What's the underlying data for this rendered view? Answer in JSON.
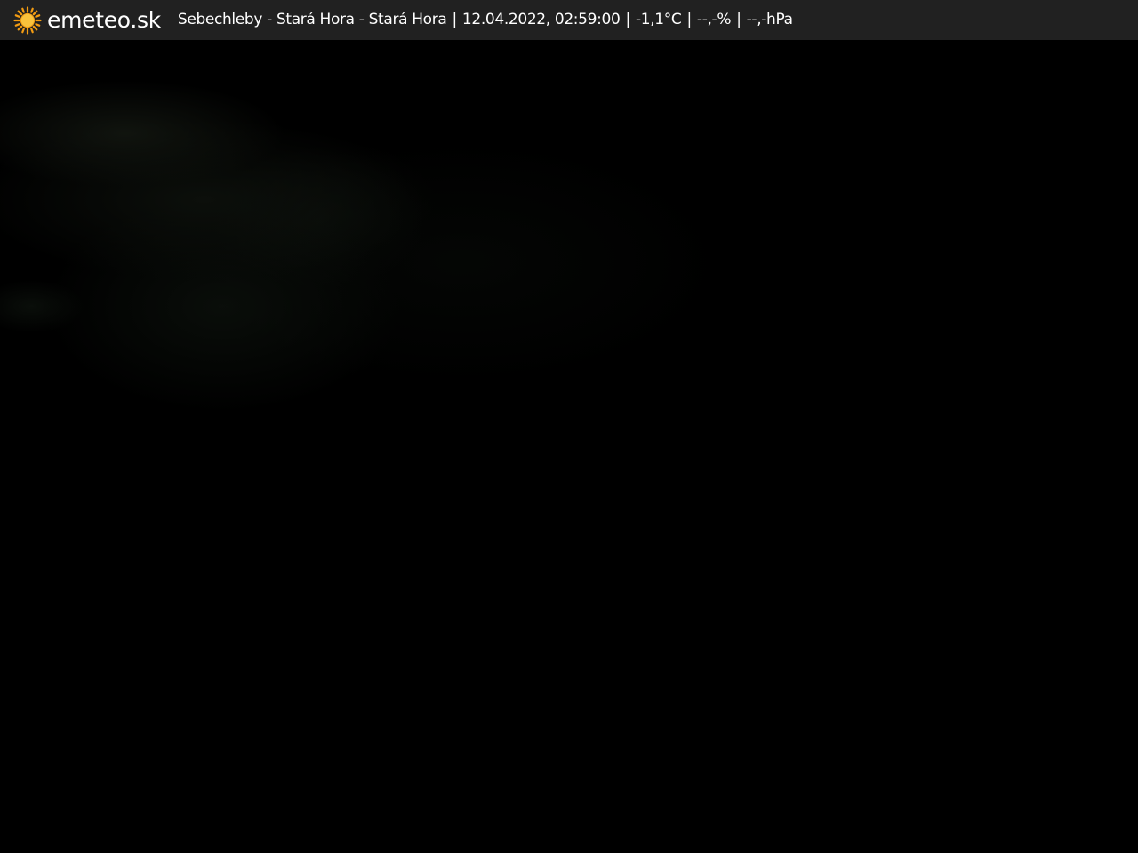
{
  "header": {
    "logo_icon": "sun-icon",
    "logo_text": "emeteo.sk",
    "location": "Sebechleby - Stará Hora - Stará Hora",
    "separator": "|",
    "datetime": "12.04.2022, 02:59:00",
    "temperature": "-1,1°C",
    "humidity": "--,-%",
    "pressure": "--,-hPa"
  },
  "colors": {
    "header_background": "#212121",
    "header_text": "#ffffff",
    "sun_core": "#f9c23c",
    "sun_rays": "#f39c12",
    "camera_background": "#000000"
  }
}
